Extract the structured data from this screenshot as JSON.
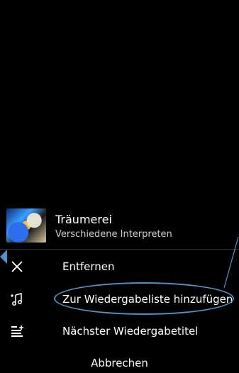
{
  "track": {
    "title": "Träumerei",
    "subtitle": "Verschiedene Interpreten",
    "art": "album-cover"
  },
  "menu": {
    "items": [
      {
        "label": "Entfernen",
        "icon": "close-icon"
      },
      {
        "label": "Zur Wiedergabeliste hinzufügen",
        "icon": "add-to-playlist-icon"
      },
      {
        "label": "Nächster Wiedergabetitel",
        "icon": "play-next-icon"
      }
    ],
    "cancel_label": "Abbrechen"
  },
  "colors": {
    "background": "#000000",
    "text": "#ffffff",
    "subtitle": "#cfcfcf",
    "accent": "#4f94c9"
  }
}
